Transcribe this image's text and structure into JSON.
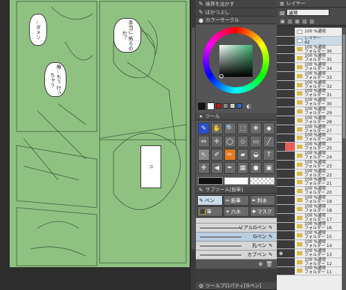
{
  "canvas": {
    "bubbles": [
      "…ダメン",
      "本当に\n怖ろの\nか？",
      "俺…もう\n行っちゃう",
      "!!"
    ]
  },
  "subtool_top": {
    "items": [
      "境界を出かす",
      "ぼかつぶし"
    ]
  },
  "color_circle": {
    "title": "カラーサークル",
    "accent": "#3cb371",
    "swatches": [
      "#111111",
      "#ffffff",
      "#c01818",
      "#888888",
      "#cccccc",
      "#3366cc"
    ]
  },
  "tools": {
    "title": "ツール",
    "icons": [
      "pen-nib",
      "hand",
      "zoom",
      "select",
      "move",
      "fill-bucket",
      "layer-move",
      "crosshair",
      "lasso",
      "eyedropper",
      "brush",
      "figure",
      "ruler",
      "pencil",
      "airbrush",
      "eraser",
      "text",
      "pattern"
    ]
  },
  "subtool": {
    "title": "サブツール[鉛筆]",
    "tabs": [
      "ペン",
      "鉛筆",
      "料水",
      "筆",
      "六水",
      "マスク"
    ],
    "brushes": [
      "リアルGペン",
      "Gペン",
      "丸ペン",
      "カブペン"
    ],
    "selected_index": 1
  },
  "tool_property": {
    "title": "ツールプロパティ[Gペン]"
  },
  "layers": {
    "tab": "レイヤー",
    "blend_mode": "通常",
    "items": [
      {
        "opacity": "100 %通常",
        "name": ""
      },
      {
        "opacity": "レイヤー",
        "name": "42"
      },
      {
        "opacity": "100 %通常",
        "name": "フォルダー 36"
      },
      {
        "opacity": "100 %通常",
        "name": "フォルダー 35"
      },
      {
        "opacity": "100 %通常",
        "name": "フォルダー 34"
      },
      {
        "opacity": "100 %通常",
        "name": "フォルダー 33"
      },
      {
        "opacity": "100 %通常",
        "name": "フォルダー 32"
      },
      {
        "opacity": "100 %通常",
        "name": "フォルダー 31"
      },
      {
        "opacity": "100 %通常",
        "name": "フォルダー 30"
      },
      {
        "opacity": "100 %通常",
        "name": "フォルダー 29"
      },
      {
        "opacity": "100 %通常",
        "name": "フォルダー 28"
      },
      {
        "opacity": "100 %通常",
        "name": "フォルダー 27"
      },
      {
        "opacity": "100 %通常",
        "name": "フォルダー 26"
      },
      {
        "opacity": "100 %通常",
        "name": "フォルダー 25"
      },
      {
        "opacity": "100 %通常",
        "name": "フォルダー 24"
      },
      {
        "opacity": "100 %通常",
        "name": "フォルダー 23"
      },
      {
        "opacity": "100 %通常",
        "name": "フォルダー 22"
      },
      {
        "opacity": "100 %通常",
        "name": "フォルダー 21"
      },
      {
        "opacity": "100 %通常",
        "name": "フォルダー 20"
      },
      {
        "opacity": "100 %通常",
        "name": "フォルダー 19"
      },
      {
        "opacity": "100 %通常",
        "name": "フォルダー 18"
      },
      {
        "opacity": "100 %通常",
        "name": "フォルダー 17"
      },
      {
        "opacity": "100 %通常",
        "name": "フォルダー 16"
      },
      {
        "opacity": "100 %通常",
        "name": "フォルダー 15"
      },
      {
        "opacity": "100 %通常",
        "name": "フォルダー 14"
      },
      {
        "opacity": "100 %通常",
        "name": "フォルダー 13"
      },
      {
        "opacity": "100 %通常",
        "name": "フォルダー 12"
      },
      {
        "opacity": "100 %通常",
        "name": "フォルダー 11"
      }
    ]
  }
}
